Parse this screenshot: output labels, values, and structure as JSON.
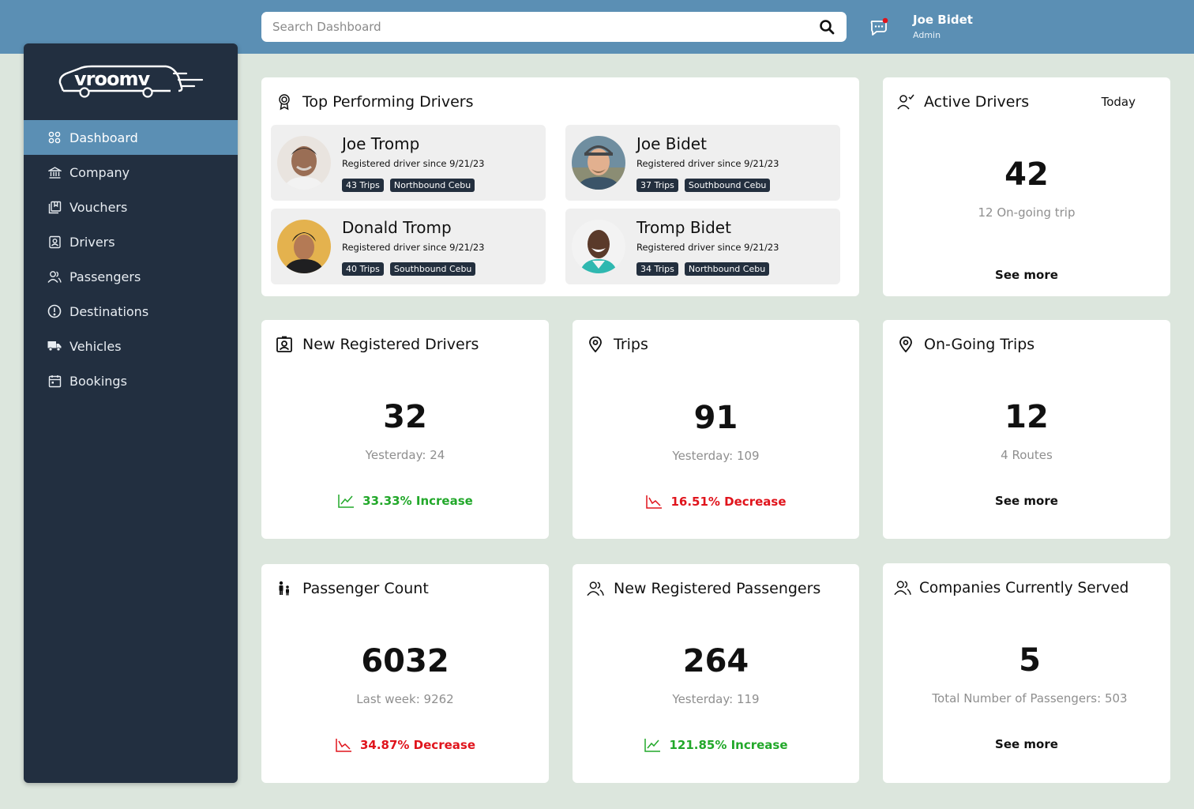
{
  "search": {
    "placeholder": "Search Dashboard"
  },
  "user": {
    "name": "Joe Bidet",
    "role": "Admin"
  },
  "logo": {
    "text": "vroomv"
  },
  "sidebar": {
    "items": [
      {
        "label": "Dashboard",
        "icon": "grid-icon",
        "active": true
      },
      {
        "label": "Company",
        "icon": "bank-icon"
      },
      {
        "label": "Vouchers",
        "icon": "voucher-icon"
      },
      {
        "label": "Drivers",
        "icon": "id-badge-icon"
      },
      {
        "label": "Passengers",
        "icon": "users-icon"
      },
      {
        "label": "Destinations",
        "icon": "alert-circle-icon"
      },
      {
        "label": "Vehicles",
        "icon": "truck-icon"
      },
      {
        "label": "Bookings",
        "icon": "calendar-icon"
      }
    ]
  },
  "top_drivers": {
    "title": "Top Performing Drivers",
    "drivers": [
      {
        "name": "Joe Tromp",
        "since": "Registered driver since 9/21/23",
        "trips": "43 Trips",
        "route": "Northbound Cebu"
      },
      {
        "name": "Joe Bidet",
        "since": "Registered driver since 9/21/23",
        "trips": "37 Trips",
        "route": "Southbound Cebu"
      },
      {
        "name": "Donald Tromp",
        "since": "Registered driver since 9/21/23",
        "trips": "40 Trips",
        "route": "Southbound Cebu"
      },
      {
        "name": "Tromp Bidet",
        "since": "Registered driver since 9/21/23",
        "trips": "34 Trips",
        "route": "Northbound Cebu"
      }
    ]
  },
  "active_drivers": {
    "title": "Active Drivers",
    "period": "Today",
    "value": "42",
    "sub": "12 On-going trip",
    "more": "See more"
  },
  "new_drivers": {
    "title": "New Registered Drivers",
    "value": "32",
    "sub": "Yesterday: 24",
    "trend": "33.33% Increase",
    "trend_color": "#22a82a"
  },
  "trips": {
    "title": "Trips",
    "value": "91",
    "sub": "Yesterday: 109",
    "trend": "16.51% Decrease",
    "trend_color": "#e0141c"
  },
  "ongoing": {
    "title": "On-Going Trips",
    "value": "12",
    "sub": "4 Routes",
    "more": "See more"
  },
  "passenger_count": {
    "title": "Passenger Count",
    "value": "6032",
    "sub": "Last week: 9262",
    "trend": "34.87% Decrease",
    "trend_color": "#e0141c"
  },
  "new_passengers": {
    "title": "New Registered Passengers",
    "value": "264",
    "sub": "Yesterday: 119",
    "trend": "121.85% Increase",
    "trend_color": "#22a82a"
  },
  "companies": {
    "title": "Companies Currently Served",
    "value": "5",
    "sub": "Total Number of Passengers: 503",
    "more": "See more"
  },
  "colors": {
    "topbar": "#5b8fb4",
    "sidebar": "#222f40",
    "background": "#dce6dd",
    "increase": "#22a82a",
    "decrease": "#e0141c"
  }
}
